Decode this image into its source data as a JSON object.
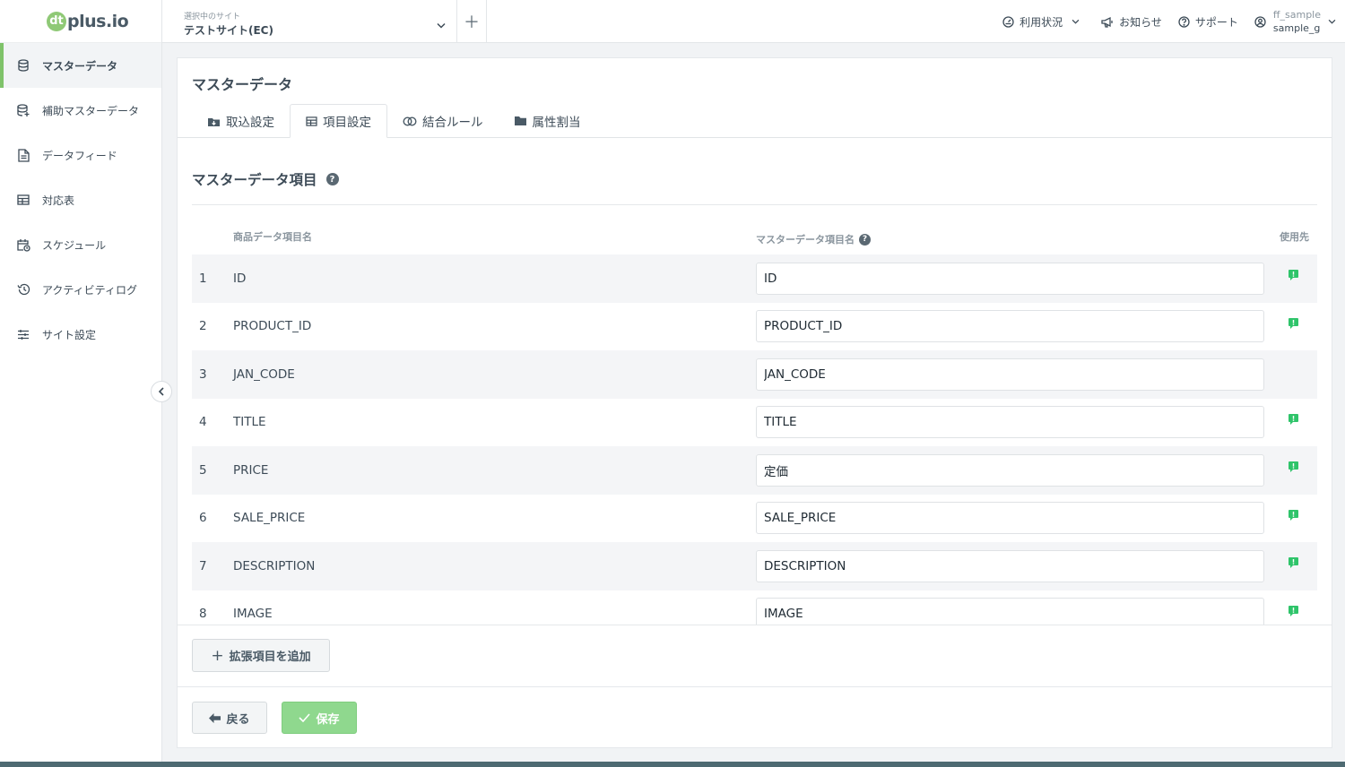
{
  "brand": {
    "mark": "dt",
    "name": "plus.io"
  },
  "sidebar": {
    "items": [
      {
        "label": "マスターデータ",
        "icon": "database-icon",
        "active": true
      },
      {
        "label": "補助マスターデータ",
        "icon": "database-plus-icon"
      },
      {
        "label": "データフィード",
        "icon": "file-icon"
      },
      {
        "label": "対応表",
        "icon": "table-icon"
      },
      {
        "label": "スケジュール",
        "icon": "calendar-clock-icon"
      },
      {
        "label": "アクティビティログ",
        "icon": "history-icon"
      },
      {
        "label": "サイト設定",
        "icon": "sliders-icon"
      }
    ]
  },
  "header": {
    "site_label": "選択中のサイト",
    "site_name": "テストサイト(EC)",
    "usage": "利用状況",
    "notice": "お知らせ",
    "support": "サポート",
    "user_top": "ff_sample",
    "user_bottom": "sample_g"
  },
  "main": {
    "title": "マスターデータ",
    "tabs": [
      {
        "label": "取込設定",
        "icon": "download-box-icon"
      },
      {
        "label": "項目設定",
        "icon": "table-icon",
        "active": true
      },
      {
        "label": "結合ルール",
        "icon": "merge-circles-icon"
      },
      {
        "label": "属性割当",
        "icon": "folder-icon"
      }
    ],
    "section_title": "マスターデータ項目",
    "columns": {
      "product_field": "商品データ項目名",
      "master_field": "マスターデータ項目名",
      "usage": "使用先"
    },
    "rows": [
      {
        "num": "1",
        "field": "ID",
        "value": "ID",
        "used": true
      },
      {
        "num": "2",
        "field": "PRODUCT_ID",
        "value": "PRODUCT_ID",
        "used": true
      },
      {
        "num": "3",
        "field": "JAN_CODE",
        "value": "JAN_CODE",
        "used": false
      },
      {
        "num": "4",
        "field": "TITLE",
        "value": "TITLE",
        "used": true
      },
      {
        "num": "5",
        "field": "PRICE",
        "value": "定価",
        "used": true
      },
      {
        "num": "6",
        "field": "SALE_PRICE",
        "value": "SALE_PRICE",
        "used": true
      },
      {
        "num": "7",
        "field": "DESCRIPTION",
        "value": "DESCRIPTION",
        "used": true
      },
      {
        "num": "8",
        "field": "IMAGE",
        "value": "IMAGE",
        "used": true
      }
    ],
    "add_button": "拡張項目を追加",
    "back_button": "戻る",
    "save_button": "保存"
  },
  "colors": {
    "accent": "#7fc36a",
    "usage_badge": "#2fc46a",
    "save_bg": "#8fd88e"
  }
}
